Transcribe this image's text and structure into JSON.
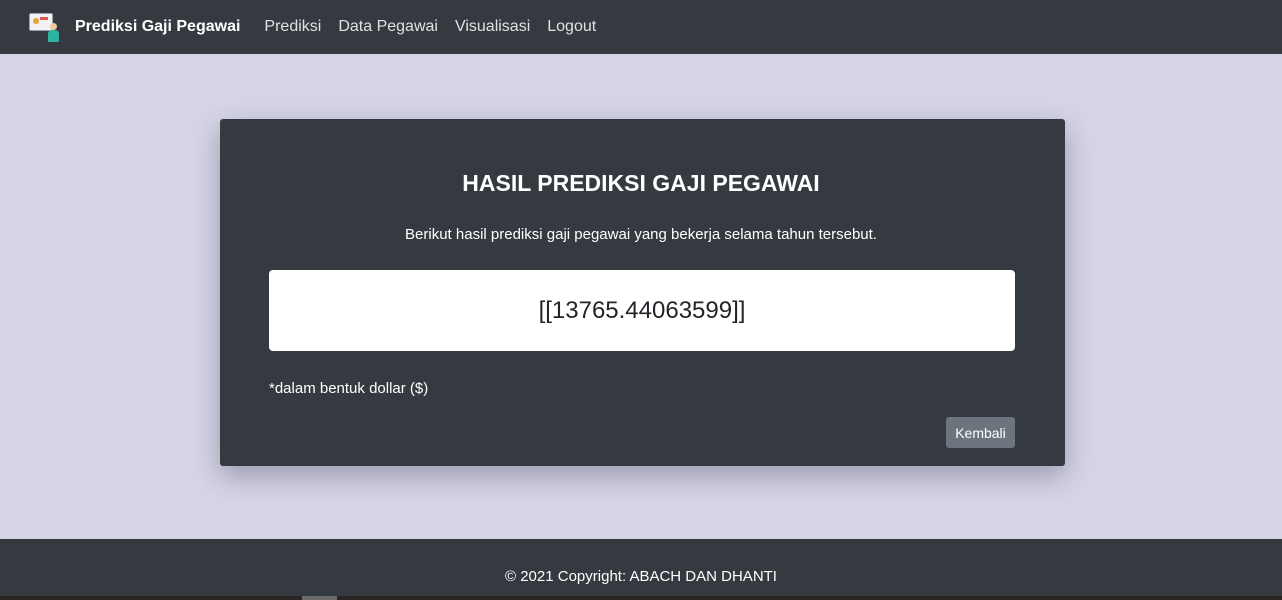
{
  "navbar": {
    "brand": "Prediksi Gaji Pegawai",
    "links": [
      "Prediksi",
      "Data Pegawai",
      "Visualisasi",
      "Logout"
    ]
  },
  "result_card": {
    "title": "HASIL PREDIKSI GAJI PEGAWAI",
    "subtitle": "Berikut hasil prediksi gaji pegawai yang bekerja selama tahun tersebut.",
    "value": "[[13765.44063599]]",
    "note": "*dalam bentuk dollar ($)",
    "back_button": "Kembali"
  },
  "footer": {
    "copyright": "© 2021 Copyright: ABACH DAN DHANTI"
  },
  "colors": {
    "page_background": "#d6d5e6",
    "dark": "#343a40",
    "button_secondary": "#6c757d"
  }
}
